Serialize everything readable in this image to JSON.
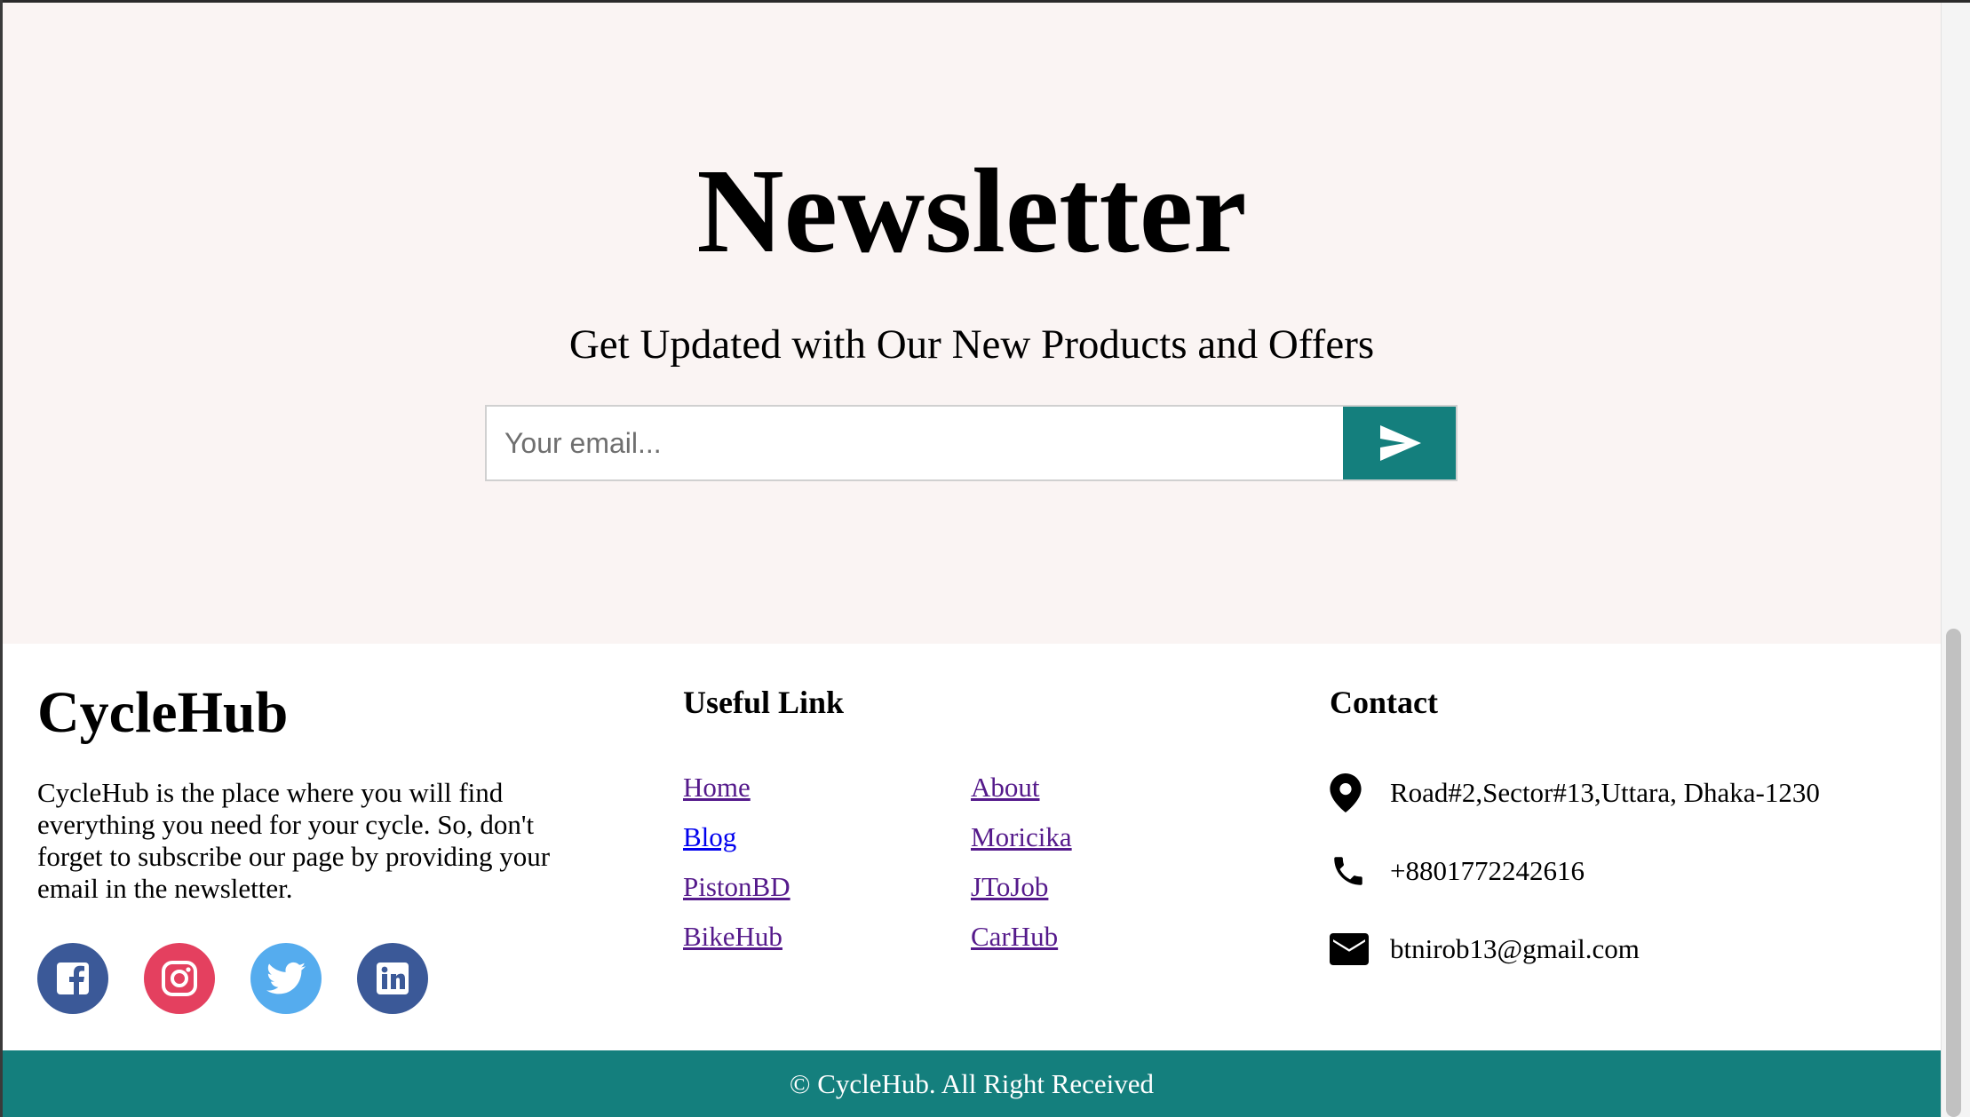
{
  "newsletter": {
    "title": "Newsletter",
    "subtitle": "Get Updated with Our New Products and Offers",
    "email_placeholder": "Your email...",
    "submit_icon": "send-icon"
  },
  "footer": {
    "brand": {
      "title": "CycleHub",
      "description": "CycleHub is the place where you will find everything you need for your cycle. So, don't forget to subscribe our page by providing your email in the newsletter."
    },
    "social": [
      {
        "icon": "facebook-icon",
        "color": "#3b5998"
      },
      {
        "icon": "instagram-icon",
        "color": "#e4405f"
      },
      {
        "icon": "twitter-icon",
        "color": "#55acee"
      },
      {
        "icon": "linkedin-icon",
        "color": "#3b5998"
      }
    ],
    "useful_links": {
      "title": "Useful Link",
      "items": [
        "Home",
        "About",
        "Blog",
        "Moricika",
        "PistonBD",
        "JToJob",
        "BikeHub",
        "CarHub"
      ]
    },
    "contact": {
      "title": "Contact",
      "address": "Road#2,Sector#13,Uttara, Dhaka-1230",
      "phone": "+8801772242616",
      "email": "btnirob13@gmail.com",
      "icons": [
        "location-pin-icon",
        "phone-icon",
        "mail-icon"
      ]
    }
  },
  "bottom_bar": {
    "copyright": "© CycleHub. All Right Received"
  },
  "colors": {
    "accent": "#147f7d",
    "newsletter_bg": "#faf4f3"
  }
}
